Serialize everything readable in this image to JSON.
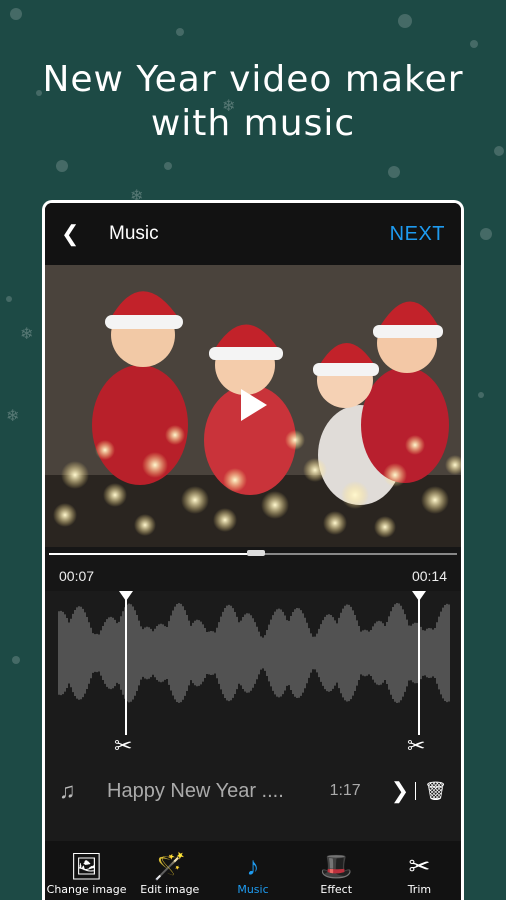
{
  "headline": {
    "line1": "New Year video maker",
    "line2": "with music"
  },
  "appbar": {
    "back_icon": "chevron-left-icon",
    "title": "Music",
    "next_label": "NEXT"
  },
  "player": {
    "progress": 0.5,
    "start_time": "00:07",
    "end_time": "00:14"
  },
  "song": {
    "name": "Happy New Year ....",
    "duration": "1:17"
  },
  "toolbar": {
    "items": [
      {
        "label": "Change image",
        "icon": "image-icon"
      },
      {
        "label": "Edit image",
        "icon": "magic-wand-icon"
      },
      {
        "label": "Music",
        "icon": "music-note-icon"
      },
      {
        "label": "Effect",
        "icon": "magic-hat-icon"
      },
      {
        "label": "Trim",
        "icon": "scissors-icon"
      }
    ],
    "active_index": 2
  },
  "colors": {
    "accent": "#1e9bf0",
    "background": "#1d4a45"
  }
}
